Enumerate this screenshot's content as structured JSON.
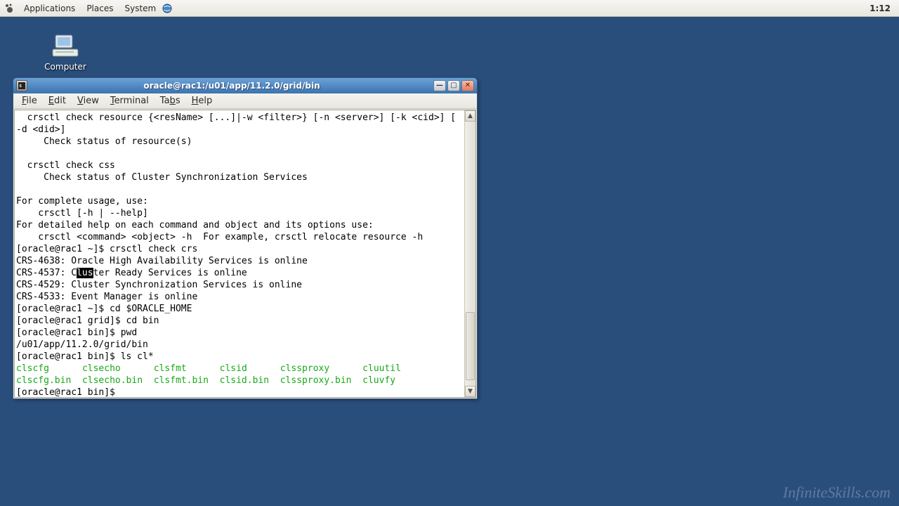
{
  "panel": {
    "menus": [
      "Applications",
      "Places",
      "System"
    ],
    "clock": "1:12"
  },
  "desktop": {
    "computer_label": "Computer"
  },
  "window": {
    "title": "oracle@rac1:/u01/app/11.2.0/grid/bin",
    "menus": [
      {
        "ul": "F",
        "rest": "ile"
      },
      {
        "ul": "E",
        "rest": "dit"
      },
      {
        "ul": "V",
        "rest": "iew"
      },
      {
        "ul": "T",
        "rest": "erminal"
      },
      {
        "ul": "",
        "rest": "Ta",
        "ul2": "b",
        "rest2": "s"
      },
      {
        "ul": "H",
        "rest": "elp"
      }
    ]
  },
  "terminal": {
    "lines": [
      {
        "t": "  crsctl check resource {<resName> [...]|-w <filter>} [-n <server>] [-k <cid>] ["
      },
      {
        "t": "-d <did>]"
      },
      {
        "t": "     Check status of resource(s)"
      },
      {
        "t": ""
      },
      {
        "t": "  crsctl check css"
      },
      {
        "t": "     Check status of Cluster Synchronization Services"
      },
      {
        "t": ""
      },
      {
        "t": "For complete usage, use:"
      },
      {
        "t": "    crsctl [-h | --help]"
      },
      {
        "t": "For detailed help on each command and object and its options use:"
      },
      {
        "t": "    crsctl <command> <object> -h  For example, crsctl relocate resource -h"
      },
      {
        "t": "[oracle@rac1 ~]$ crsctl check crs"
      },
      {
        "t": "CRS-4638: Oracle High Availability Services is online"
      },
      {
        "seg": [
          {
            "t": "CRS-4537: C"
          },
          {
            "t": "lus",
            "sel": true
          },
          {
            "t": "ter Ready Services is online"
          }
        ]
      },
      {
        "t": "CRS-4529: Cluster Synchronization Services is online"
      },
      {
        "t": "CRS-4533: Event Manager is online"
      },
      {
        "t": "[oracle@rac1 ~]$ cd $ORACLE_HOME"
      },
      {
        "t": "[oracle@rac1 grid]$ cd bin"
      },
      {
        "t": "[oracle@rac1 bin]$ pwd"
      },
      {
        "t": "/u01/app/11.2.0/grid/bin"
      },
      {
        "t": "[oracle@rac1 bin]$ ls cl*"
      },
      {
        "seg": [
          {
            "t": "clscfg",
            "g": true
          },
          {
            "t": "      "
          },
          {
            "t": "clsecho",
            "g": true
          },
          {
            "t": "      "
          },
          {
            "t": "clsfmt",
            "g": true
          },
          {
            "t": "      "
          },
          {
            "t": "clsid",
            "g": true
          },
          {
            "t": "      "
          },
          {
            "t": "clssproxy",
            "g": true
          },
          {
            "t": "      "
          },
          {
            "t": "cluutil",
            "g": true
          }
        ]
      },
      {
        "seg": [
          {
            "t": "clscfg.bin",
            "g": true
          },
          {
            "t": "  "
          },
          {
            "t": "clsecho.bin",
            "g": true
          },
          {
            "t": "  "
          },
          {
            "t": "clsfmt.bin",
            "g": true
          },
          {
            "t": "  "
          },
          {
            "t": "clsid.bin",
            "g": true
          },
          {
            "t": "  "
          },
          {
            "t": "clssproxy.bin",
            "g": true
          },
          {
            "t": "  "
          },
          {
            "t": "cluvfy",
            "g": true
          }
        ]
      },
      {
        "t": "[oracle@rac1 bin]$ "
      }
    ]
  },
  "watermark": "InfiniteSkills.com"
}
